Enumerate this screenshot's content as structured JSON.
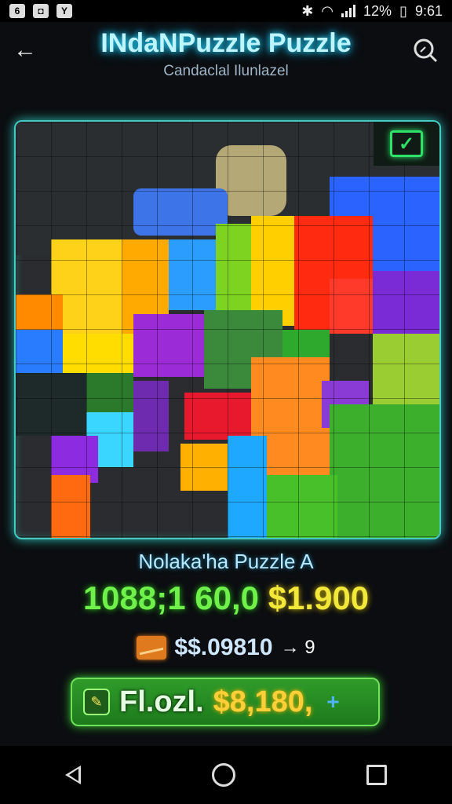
{
  "status_bar": {
    "notification_icons": [
      "6",
      "◘",
      "Y"
    ],
    "battery": "12%",
    "time": "9:61",
    "icons": [
      "bluetooth-icon",
      "wifi-icon",
      "signal-icon"
    ]
  },
  "header": {
    "title": "INdaNPuzzIe Puzzle",
    "subtitle": "Candaclal Ilunlazel",
    "back_icon": "arrow-left-icon",
    "search_icon": "search-icon"
  },
  "board": {
    "complete_icon": "checkmark-icon",
    "accent": "#45c9c0"
  },
  "info": {
    "puzzle_name": "Nolaka'ha Puzzle A",
    "stat_part1": "1088;1 60,0",
    "stat_part2": "$1.900",
    "reward_amount": "$$.09810",
    "reward_arrow": "→ 9"
  },
  "action": {
    "label": "Fl.ozl.",
    "price": "$8,180,",
    "plus": "+",
    "icon": "leaf-pencil-icon",
    "color": "#2f9c2a"
  },
  "nav": {
    "back": "nav-back-icon",
    "home": "nav-home-icon",
    "recent": "nav-recent-icon"
  }
}
